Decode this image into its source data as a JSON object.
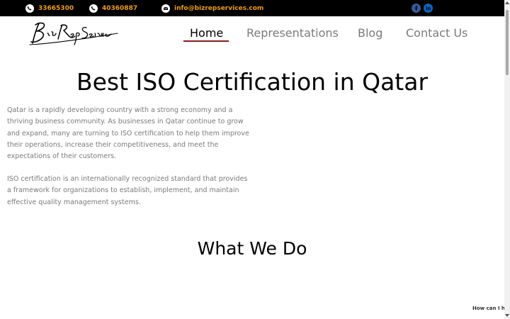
{
  "topbar": {
    "phone1": "33665300",
    "phone2": "40360887",
    "email": "info@bizrepservices.com",
    "accent_color": "#f39c12",
    "phone_icon": "phone-icon",
    "email_icon": "envelope-icon",
    "social": [
      {
        "name": "facebook",
        "icon": "facebook-icon",
        "color": "#3b5998"
      },
      {
        "name": "linkedin",
        "icon": "linkedin-icon",
        "color": "#0a66c2"
      }
    ]
  },
  "header": {
    "logo_text": "BizRep Services",
    "nav": [
      {
        "label": "Home",
        "active": true
      },
      {
        "label": "Representations",
        "active": false
      },
      {
        "label": "Blog",
        "active": false
      },
      {
        "label": "Contact Us",
        "active": false
      }
    ],
    "active_underline_color": "#8b1a1a"
  },
  "main": {
    "title": "Best ISO Certification in Qatar",
    "paragraphs": [
      "Qatar is a rapidly developing country with a strong economy and a thriving business community. As businesses in Qatar continue to grow and expand, many are turning to ISO certification to help them improve their operations, increase their competitiveness, and meet the expectations of their customers.",
      "ISO certification is an internationally recognized standard that provides a framework for organizations to establish, implement, and maintain effective quality management systems."
    ],
    "section_title": "What We Do"
  },
  "chat": {
    "hint": "How can I hel"
  }
}
